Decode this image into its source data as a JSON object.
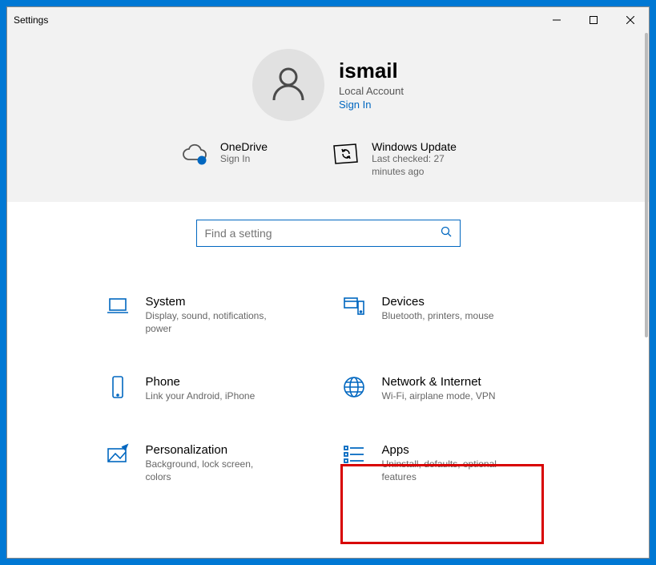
{
  "window": {
    "title": "Settings"
  },
  "account": {
    "name": "ismail",
    "type": "Local Account",
    "signin": "Sign In"
  },
  "status": {
    "onedrive": {
      "title": "OneDrive",
      "sub": "Sign In"
    },
    "update": {
      "title": "Windows Update",
      "sub": "Last checked: 27 minutes ago"
    }
  },
  "search": {
    "placeholder": "Find a setting"
  },
  "categories": {
    "system": {
      "title": "System",
      "desc": "Display, sound, notifications, power"
    },
    "devices": {
      "title": "Devices",
      "desc": "Bluetooth, printers, mouse"
    },
    "phone": {
      "title": "Phone",
      "desc": "Link your Android, iPhone"
    },
    "network": {
      "title": "Network & Internet",
      "desc": "Wi-Fi, airplane mode, VPN"
    },
    "personal": {
      "title": "Personalization",
      "desc": "Background, lock screen, colors"
    },
    "apps": {
      "title": "Apps",
      "desc": "Uninstall, defaults, optional features"
    }
  },
  "colors": {
    "accent": "#0067c0",
    "highlight": "#d80000"
  }
}
